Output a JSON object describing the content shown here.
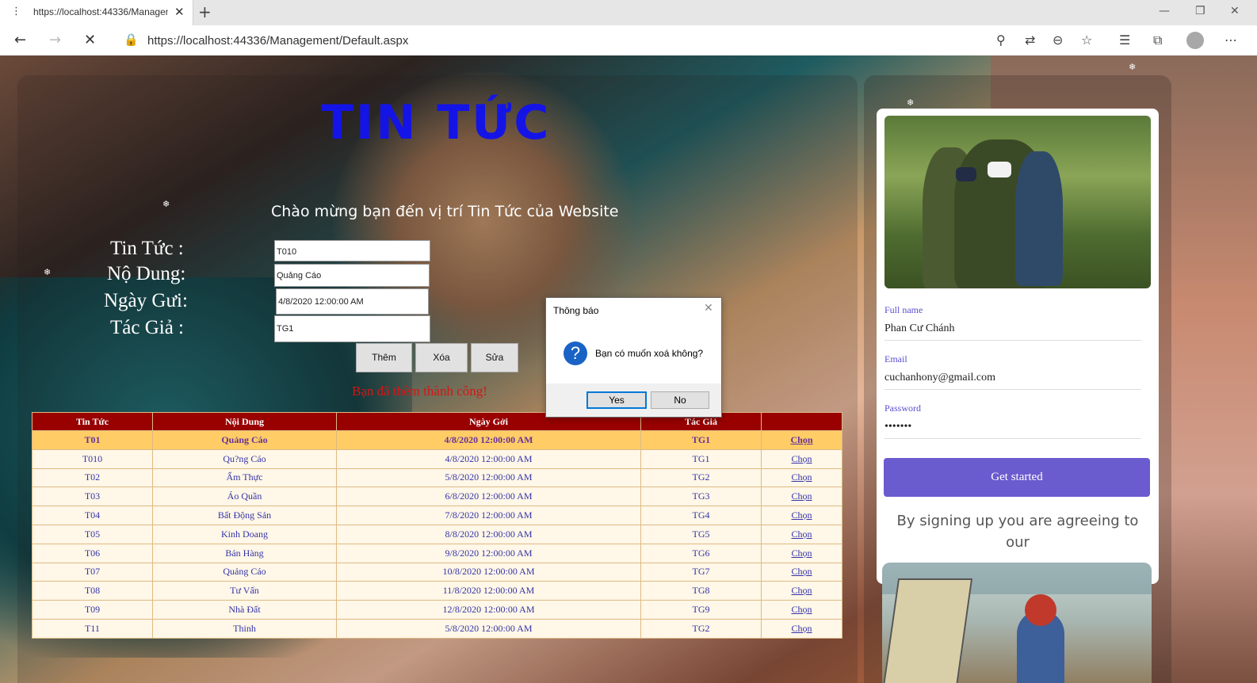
{
  "browser": {
    "tab_title": "https://localhost:44336/Managem",
    "url": "https://localhost:44336/Management/Default.aspx"
  },
  "page": {
    "title": "TIN TỨC",
    "welcome": "Chào mừng bạn đến vị trí Tin Tức của Website",
    "form": {
      "tin_tuc_label": "Tin Tức :",
      "noi_dung_label": "Nộ Dung:",
      "ngay_gui_label": "Ngày Gưi:",
      "tac_gia_label": "Tác Giả :",
      "tin_tuc_value": "T010",
      "noi_dung_value": "Quảng Cáo",
      "ngay_gui_value": "4/8/2020 12:00:00 AM",
      "tac_gia_value": "TG1"
    },
    "buttons": {
      "them": "Thêm",
      "xoa": "Xóa",
      "sua": "Sửa"
    },
    "success_message": "Bạn đã thêm thành công!",
    "table": {
      "headers": [
        "Tin Tức",
        "Nội Dung",
        "Ngày Gởi",
        "Tác Giả",
        ""
      ],
      "link_label": "Chọn",
      "rows": [
        {
          "id": "T01",
          "content": "Quảng Cáo",
          "date": "4/8/2020 12:00:00 AM",
          "author": "TG1"
        },
        {
          "id": "T010",
          "content": "Qu?ng Cáo",
          "date": "4/8/2020 12:00:00 AM",
          "author": "TG1"
        },
        {
          "id": "T02",
          "content": "Ẩm Thực",
          "date": "5/8/2020 12:00:00 AM",
          "author": "TG2"
        },
        {
          "id": "T03",
          "content": "Áo Quần",
          "date": "6/8/2020 12:00:00 AM",
          "author": "TG3"
        },
        {
          "id": "T04",
          "content": "Bất Động Sản",
          "date": "7/8/2020 12:00:00 AM",
          "author": "TG4"
        },
        {
          "id": "T05",
          "content": "Kinh Doang",
          "date": "8/8/2020 12:00:00 AM",
          "author": "TG5"
        },
        {
          "id": "T06",
          "content": "Bán Hàng",
          "date": "9/8/2020 12:00:00 AM",
          "author": "TG6"
        },
        {
          "id": "T07",
          "content": "Quảng Cáo",
          "date": "10/8/2020 12:00:00 AM",
          "author": "TG7"
        },
        {
          "id": "T08",
          "content": "Tư Vấn",
          "date": "11/8/2020 12:00:00 AM",
          "author": "TG8"
        },
        {
          "id": "T09",
          "content": "Nhà Đất",
          "date": "12/8/2020 12:00:00 AM",
          "author": "TG9"
        },
        {
          "id": "T11",
          "content": "Thinh",
          "date": "5/8/2020 12:00:00 AM",
          "author": "TG2"
        }
      ]
    }
  },
  "card": {
    "full_name_label": "Full name",
    "full_name": "Phan Cư Chánh",
    "email_label": "Email",
    "email": "cuchanhony@gmail.com",
    "password_label": "Password",
    "password": "•••••••",
    "button": "Get started",
    "agree_text": "By signing up you are agreeing to our"
  },
  "dialog": {
    "title": "Thông báo",
    "message": "Bạn có muốn xoá không?",
    "yes": "Yes",
    "no": "No"
  }
}
